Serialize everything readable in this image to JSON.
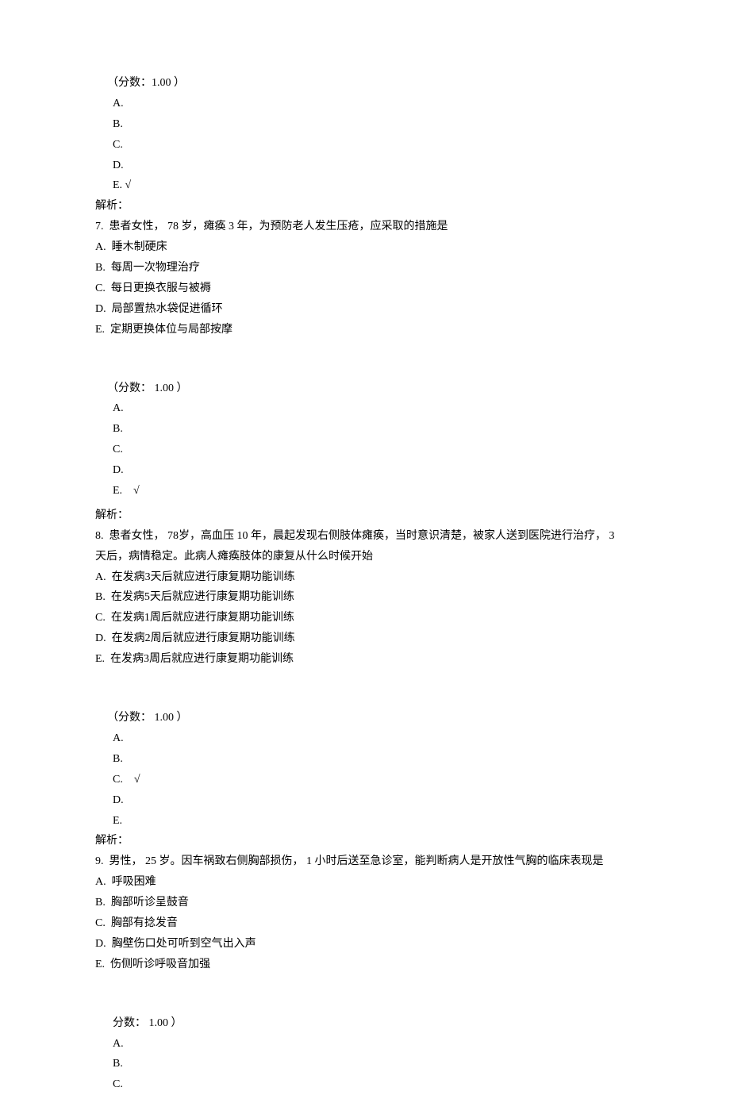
{
  "q6_block": {
    "score": "（分数：1.00 ）",
    "opts": [
      "A.",
      "B.",
      "C.",
      "D.",
      "E. √"
    ],
    "analysis": "解析："
  },
  "q7": {
    "num": "7.",
    "stem": "患者女性， 78 岁，瘫痪 3 年，为预防老人发生压疮，应采取的措施是",
    "options": [
      "A.  睡木制硬床",
      "B.  每周一次物理治疗",
      "C.  每日更换衣服与被褥",
      "D.  局部置热水袋促进循环",
      "E.  定期更换体位与局部按摩"
    ],
    "score": "（分数： 1.00 ）",
    "answer_opts": [
      "A.",
      "B.",
      "C.",
      "D.",
      "E.    √"
    ],
    "analysis": "解析："
  },
  "q8": {
    "num": "8.",
    "stem_line1": "患者女性， 78岁，高血压 10 年，晨起发现右侧肢体瘫痪，当时意识清楚，被家人送到医院进行治疗， 3",
    "stem_line2": "天后，病情稳定。此病人瘫痪肢体的康复从什么时候开始",
    "options": [
      "A.  在发病3天后就应进行康复期功能训练",
      "B.  在发病5天后就应进行康复期功能训练",
      "C.  在发病1周后就应进行康复期功能训练",
      "D.  在发病2周后就应进行康复期功能训练",
      "E.  在发病3周后就应进行康复期功能训练"
    ],
    "score": "（分数： 1.00 ）",
    "answer_opts": [
      "A.",
      "B.",
      "C.    √",
      "D.",
      "E."
    ],
    "analysis": "解析："
  },
  "q9": {
    "num": "9.",
    "stem": "男性， 25 岁。因车祸致右侧胸部损伤， 1 小时后送至急诊室，能判断病人是开放性气胸的临床表现是",
    "options": [
      "A.  呼吸困难",
      "B.  胸部听诊呈鼓音",
      "C.  胸部有捻发音",
      "D.  胸壁伤口处可听到空气出入声",
      "E.  伤侧听诊呼吸音加强"
    ],
    "score": "分数： 1.00 ）",
    "answer_opts": [
      "A.",
      "B.",
      "C."
    ]
  }
}
